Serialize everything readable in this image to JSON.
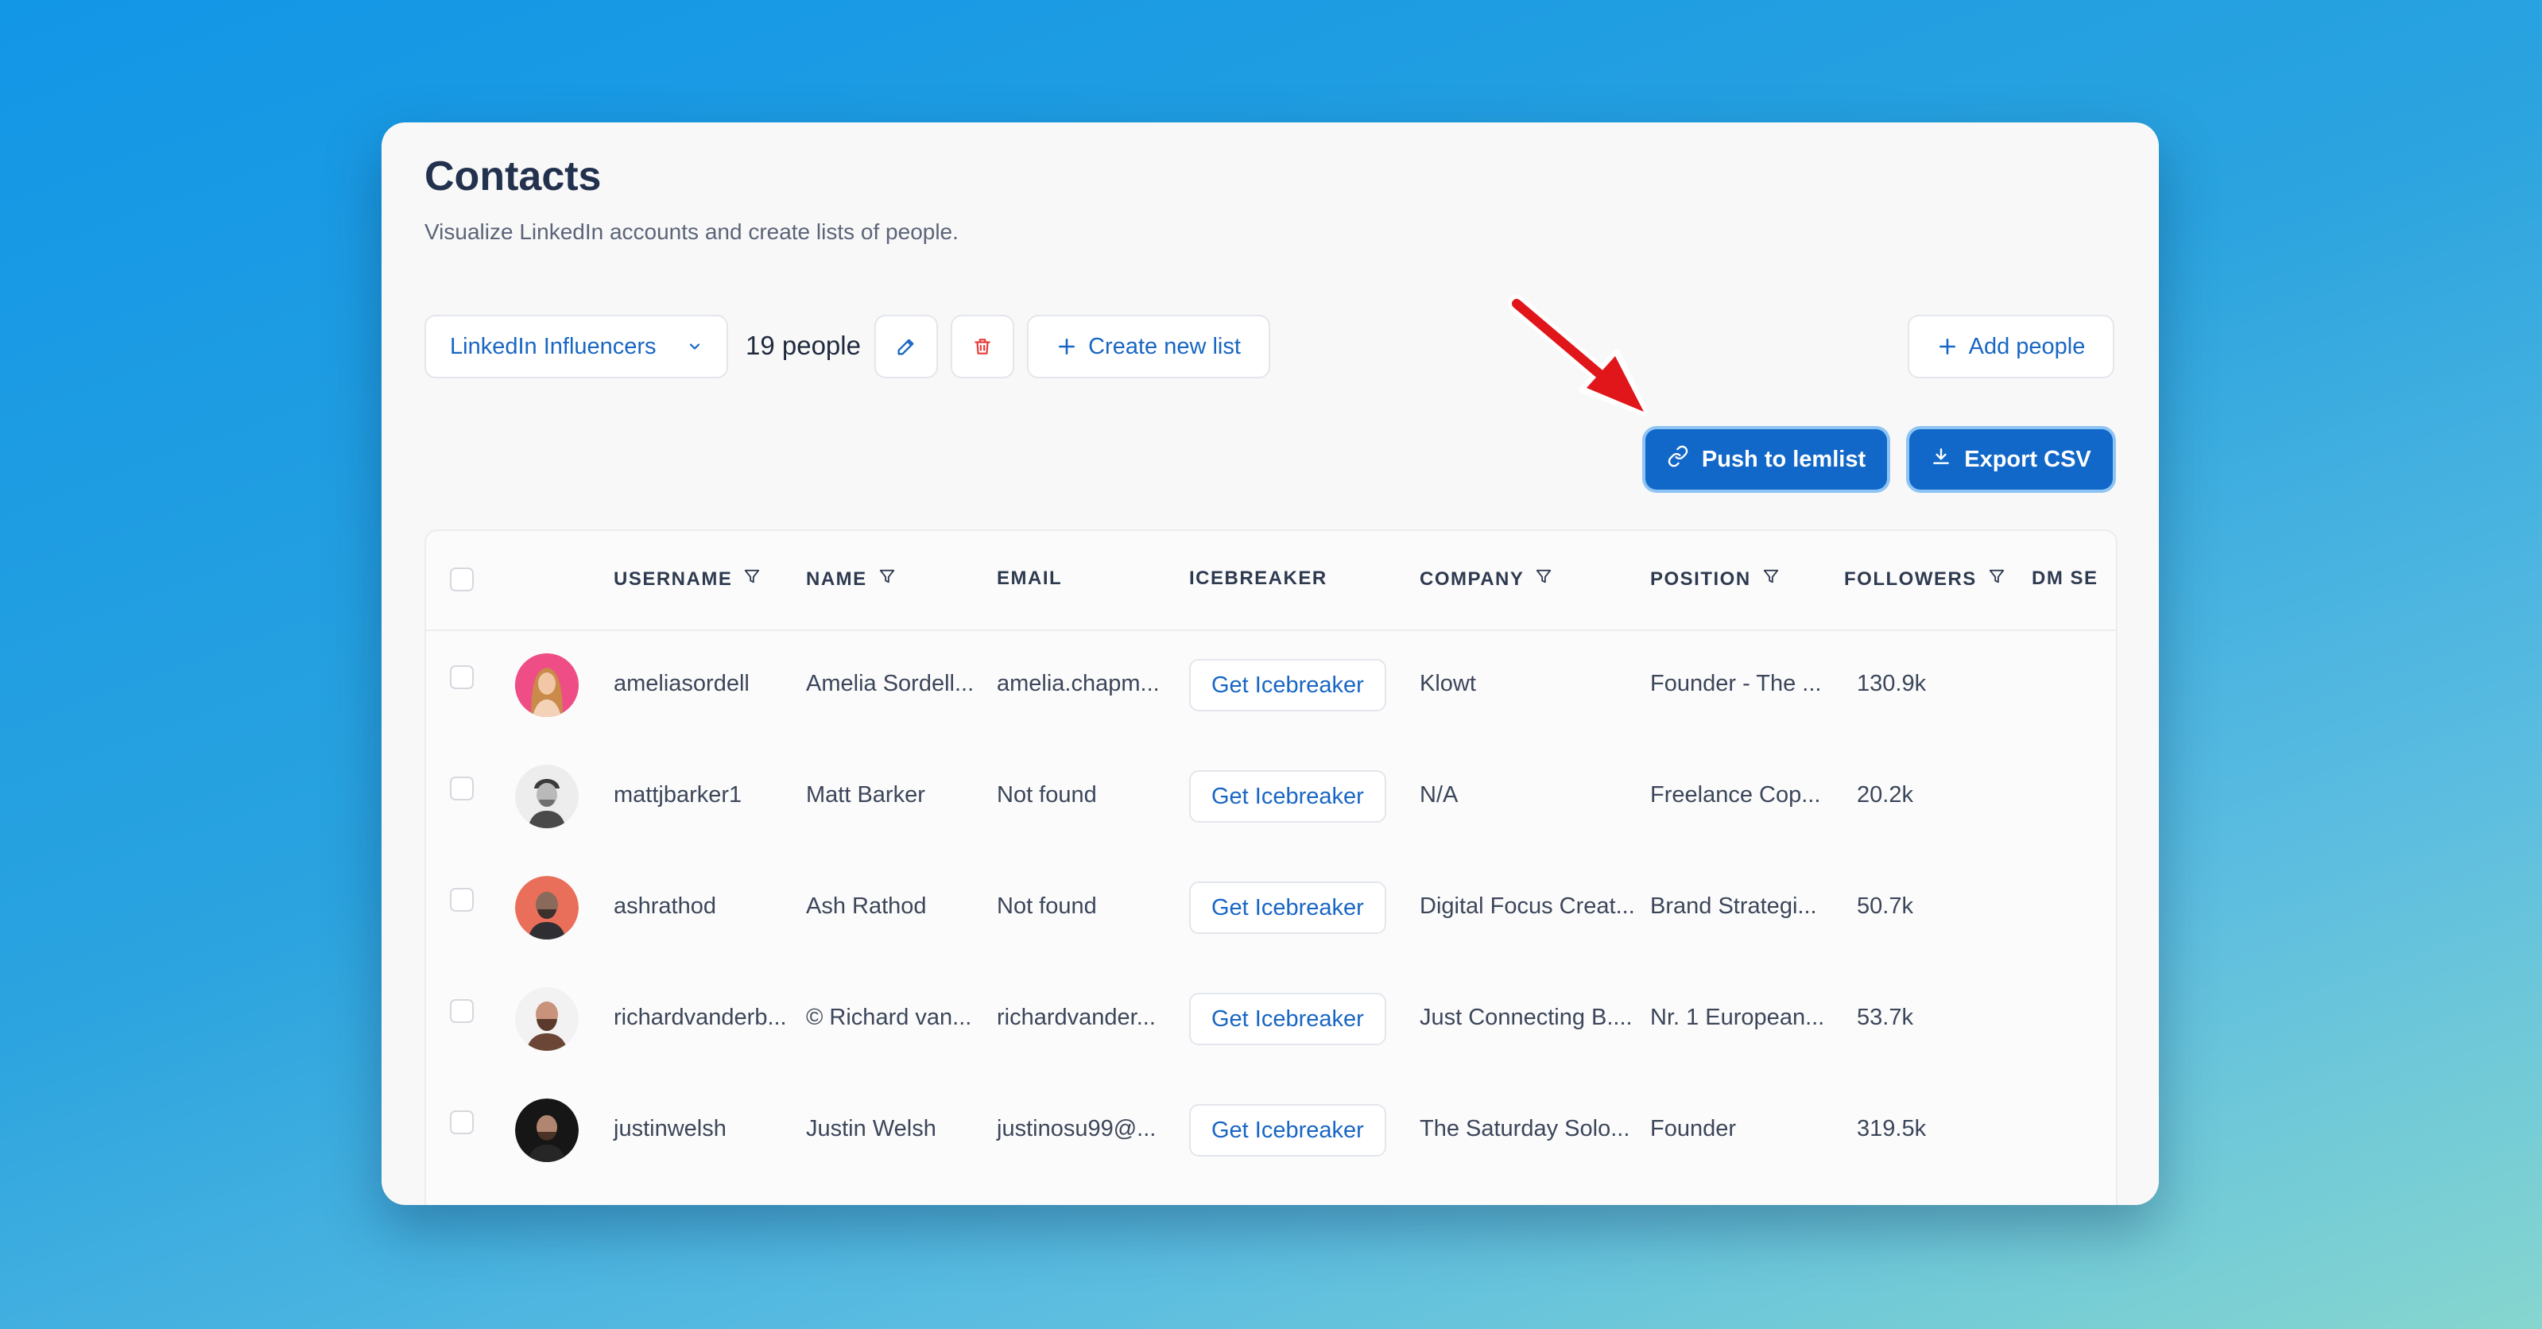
{
  "header": {
    "title": "Contacts",
    "subtitle": "Visualize LinkedIn accounts and create lists of people."
  },
  "toolbar": {
    "list_name": "LinkedIn Influencers",
    "people_count": "19 people",
    "create_list_label": "Create new list",
    "add_people_label": "Add people",
    "push_label": "Push to lemlist",
    "export_label": "Export CSV"
  },
  "table": {
    "columns": {
      "username": "USERNAME",
      "name": "NAME",
      "email": "EMAIL",
      "icebreaker": "ICEBREAKER",
      "company": "COMPANY",
      "position": "POSITION",
      "followers": "FOLLOWERS",
      "dm_sent": "DM SE"
    },
    "icebreaker_label": "Get Icebreaker",
    "rows": [
      {
        "username": "ameliasordell",
        "name": "Amelia Sordell...",
        "email": "amelia.chapm...",
        "company": "Klowt",
        "position": "Founder - The ...",
        "followers": "130.9k"
      },
      {
        "username": "mattjbarker1",
        "name": "Matt Barker",
        "email": "Not found",
        "company": "N/A",
        "position": "Freelance Cop...",
        "followers": "20.2k"
      },
      {
        "username": "ashrathod",
        "name": "Ash Rathod",
        "email": "Not found",
        "company": "Digital Focus Creat...",
        "position": "Brand Strategi...",
        "followers": "50.7k"
      },
      {
        "username": "richardvanderb...",
        "name": "© Richard van...",
        "email": "richardvander...",
        "company": "Just Connecting B....",
        "position": "Nr. 1 European...",
        "followers": "53.7k"
      },
      {
        "username": "justinwelsh",
        "name": "Justin Welsh",
        "email": "justinosu99@...",
        "company": "The Saturday Solo...",
        "position": "Founder",
        "followers": "319.5k"
      }
    ]
  },
  "colors": {
    "accent": "#1168c8",
    "link": "#1866c4",
    "danger": "#e53935",
    "annotation_arrow": "#e0161b"
  }
}
